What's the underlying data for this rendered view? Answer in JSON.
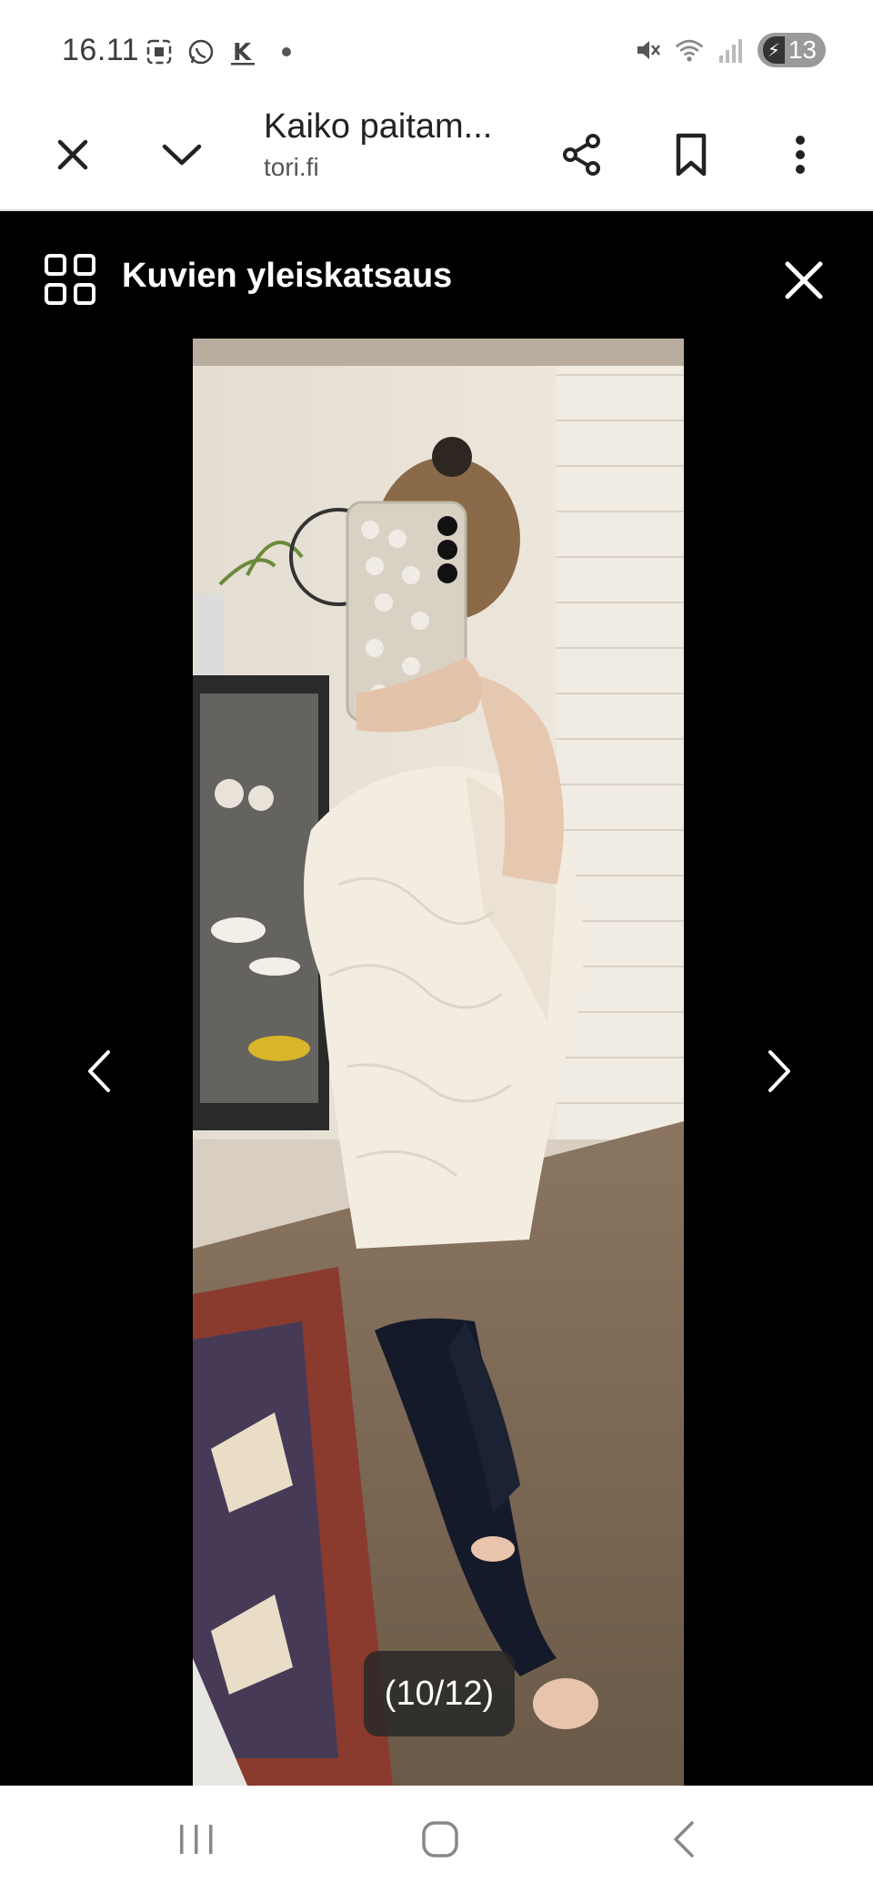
{
  "status_bar": {
    "time": "16.11",
    "battery": "13",
    "icons": [
      "screenshot-icon",
      "whatsapp-icon",
      "k-app-icon",
      "notification-dot",
      "mute-icon",
      "wifi-icon",
      "signal-icon",
      "battery-charging-icon"
    ]
  },
  "browser": {
    "title": "Kaiko paitam...",
    "domain": "tori.fi",
    "icons": [
      "close-icon",
      "chevron-down-icon",
      "share-icon",
      "bookmark-icon",
      "more-icon"
    ]
  },
  "gallery": {
    "title": "Kuvien yleiskatsaus",
    "counter": "(10/12)",
    "icons": [
      "grid-icon",
      "close-icon",
      "chevron-left-icon",
      "chevron-right-icon"
    ]
  },
  "nav_bar": {
    "icons": [
      "recents-icon",
      "home-icon",
      "back-icon"
    ]
  },
  "colors": {
    "status_bg": "#ffffff",
    "gallery_bg": "#000000",
    "counter_bg": "#282828"
  }
}
